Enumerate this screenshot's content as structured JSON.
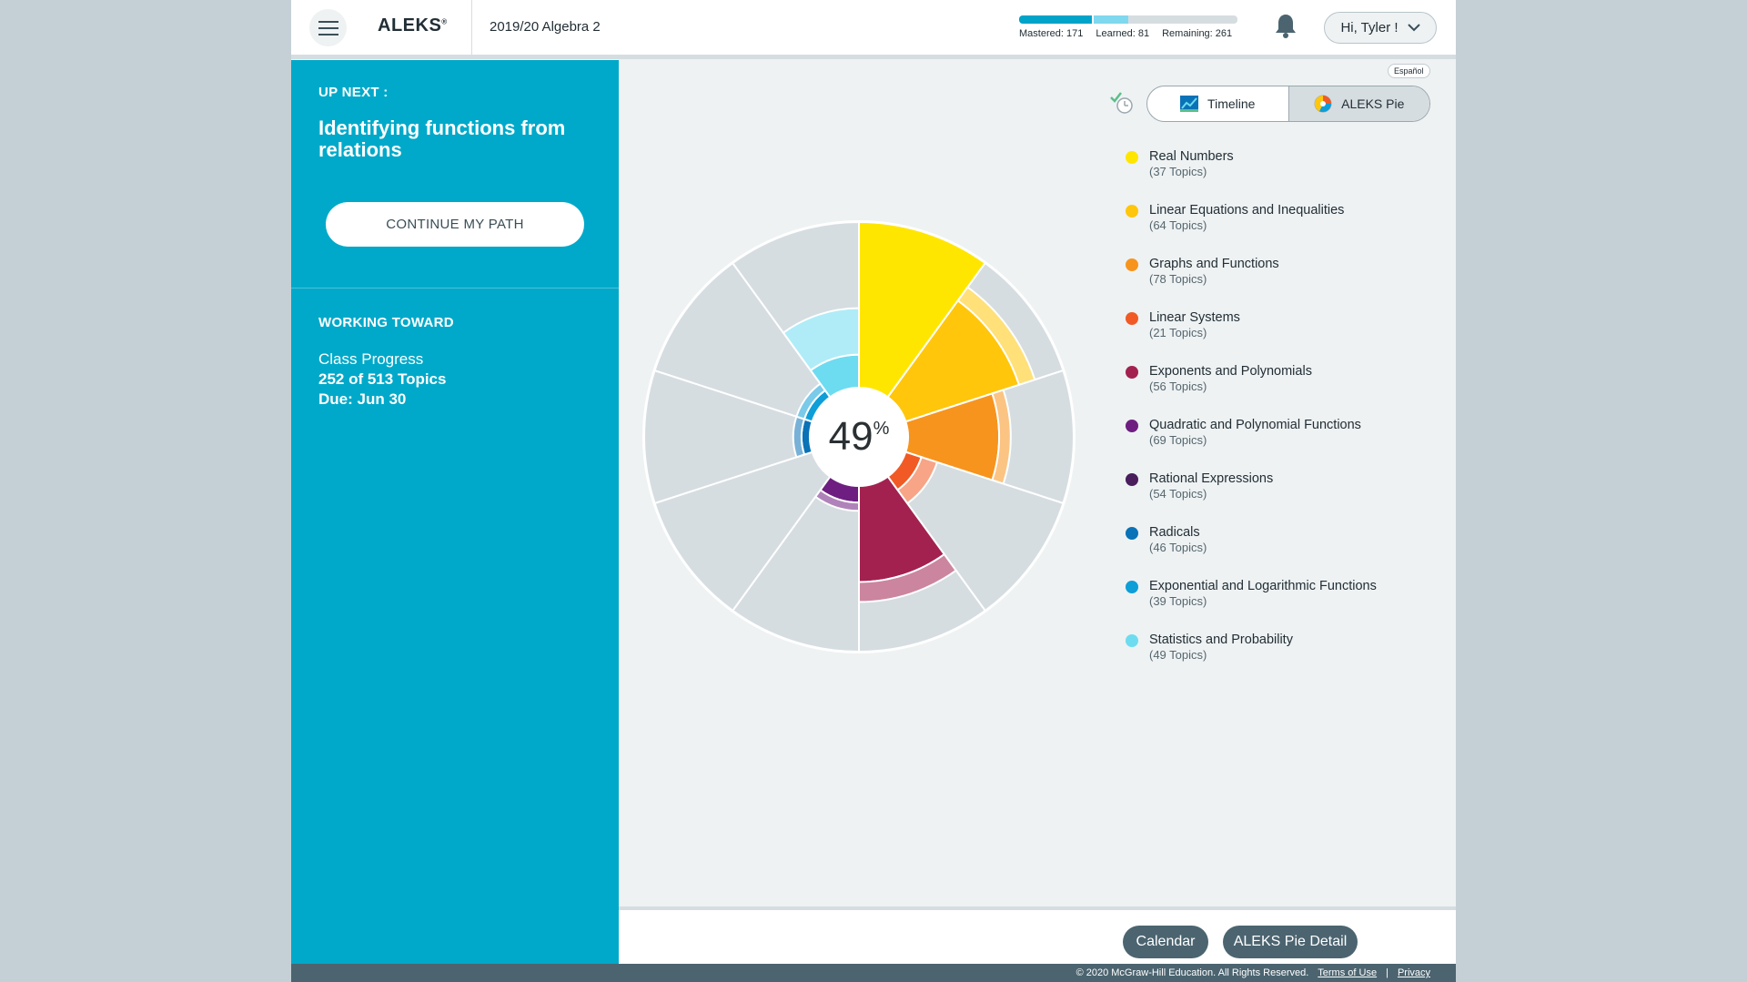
{
  "header": {
    "logo": "ALEKS",
    "logo_mark": "®",
    "course_title": "2019/20 Algebra 2",
    "progress": {
      "mastered_label": "Mastered:",
      "mastered": 171,
      "learned_label": "Learned:",
      "learned": 81,
      "remaining_label": "Remaining:",
      "remaining": 261
    },
    "user_greeting": "Hi, Tyler !"
  },
  "sidebar": {
    "up_next_label": "UP NEXT :",
    "up_next_topic": "Identifying functions from relations",
    "continue_button": "CONTINUE MY PATH",
    "working_toward_label": "WORKING TOWARD",
    "class_progress_label": "Class Progress",
    "topics_progress": "252 of 513 Topics",
    "due": "Due: Jun 30"
  },
  "main": {
    "language_button": "Español",
    "tabs": [
      {
        "label": "Timeline",
        "icon": "timeline-chart-icon",
        "active": false
      },
      {
        "label": "ALEKS Pie",
        "icon": "pie-chart-icon",
        "active": true
      }
    ],
    "pie_percent": "49",
    "pie_percent_sign": "%"
  },
  "chart_data": {
    "type": "pie",
    "title": "",
    "center_label": "49%",
    "series": [
      {
        "name": "Real Numbers",
        "topics_label": "(37 Topics)",
        "topics": 37,
        "color": "#ffe600",
        "mastered_fraction": 1.0,
        "learned_fraction": 0.0
      },
      {
        "name": "Linear Equations and Inequalities",
        "topics_label": "(64 Topics)",
        "topics": 64,
        "color": "#ffc60b",
        "mastered_fraction": 0.72,
        "learned_fraction": 0.1
      },
      {
        "name": "Graphs and Functions",
        "topics_label": "(78 Topics)",
        "topics": 78,
        "color": "#f7941d",
        "mastered_fraction": 0.55,
        "learned_fraction": 0.07
      },
      {
        "name": "Linear Systems",
        "topics_label": "(21 Topics)",
        "topics": 21,
        "color": "#f15a24",
        "mastered_fraction": 0.1,
        "learned_fraction": 0.1
      },
      {
        "name": "Exponents and Polynomials",
        "topics_label": "(56 Topics)",
        "topics": 56,
        "color": "#a3214f",
        "mastered_fraction": 0.58,
        "learned_fraction": 0.12
      },
      {
        "name": "Quadratic and Polynomial Functions",
        "topics_label": "(69 Topics)",
        "topics": 69,
        "color": "#6e1e80",
        "mastered_fraction": 0.1,
        "learned_fraction": 0.05
      },
      {
        "name": "Rational Expressions",
        "topics_label": "(54 Topics)",
        "topics": 54,
        "color": "#4a1d5c",
        "mastered_fraction": 0.0,
        "learned_fraction": 0.0
      },
      {
        "name": "Radicals",
        "topics_label": "(46 Topics)",
        "topics": 46,
        "color": "#0a72b7",
        "mastered_fraction": 0.05,
        "learned_fraction": 0.05
      },
      {
        "name": "Exponential and Logarithmic Functions",
        "topics_label": "(39 Topics)",
        "topics": 39,
        "color": "#0e9ed8",
        "mastered_fraction": 0.05,
        "learned_fraction": 0.05
      },
      {
        "name": "Statistics and Probability",
        "topics_label": "(49 Topics)",
        "topics": 49,
        "color": "#6ddcf0",
        "mastered_fraction": 0.2,
        "learned_fraction": 0.28
      }
    ]
  },
  "bottom": {
    "calendar_button": "Calendar",
    "pie_detail_button": "ALEKS Pie Detail"
  },
  "footer": {
    "copyright": "© 2020 McGraw-Hill Education. All Rights Reserved.",
    "terms": "Terms of Use",
    "separator": "|",
    "privacy": "Privacy"
  }
}
